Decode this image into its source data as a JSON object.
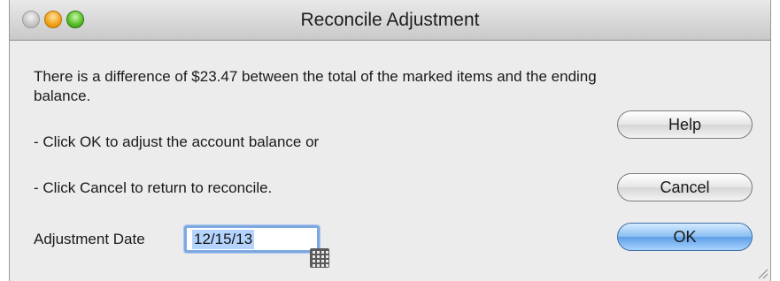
{
  "window": {
    "title": "Reconcile Adjustment"
  },
  "message": {
    "line1": "There is a difference of $23.47 between the total of the marked items and the ending balance.",
    "line2": "- Click OK to adjust the account balance or",
    "line3": "- Click Cancel to return to reconcile."
  },
  "form": {
    "date_label": "Adjustment Date",
    "date_value": "12/15/13"
  },
  "buttons": {
    "help": "Help",
    "cancel": "Cancel",
    "ok": "OK"
  },
  "icons": {
    "close": "close-button",
    "minimize": "minimize-button",
    "zoom": "zoom-button",
    "calendar": "calendar-icon",
    "resize": "resize-grip-icon"
  },
  "colors": {
    "default_button": "#5d9fe6",
    "field_focus": "#7ea9e0",
    "selection": "#b5d4fd"
  }
}
